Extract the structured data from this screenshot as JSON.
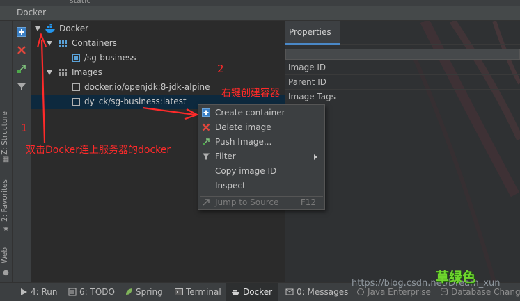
{
  "top_fragment": "static",
  "window_title": "Docker",
  "side_tabs": {
    "structure": "Z: Structure",
    "favorites": "2: Favorites",
    "web": "Web"
  },
  "tree": {
    "root": "Docker",
    "containers_label": "Containers",
    "container_item": "/sg-business",
    "images_label": "Images",
    "image_1": "docker.io/openjdk:8-jdk-alpine",
    "image_2": "dy_ck/sg-business:latest"
  },
  "properties": {
    "tab_label": "Properties",
    "rows": [
      "Image ID",
      "Parent ID",
      "Image Tags"
    ]
  },
  "context_menu": {
    "create_container": "Create container",
    "delete_image": "Delete image",
    "push_image": "Push Image...",
    "filter": "Filter",
    "copy_image_id": "Copy image ID",
    "inspect": "Inspect",
    "jump_to_source": "Jump to Source",
    "jump_shortcut": "F12"
  },
  "bottom_tabs": {
    "run": "4: Run",
    "todo": "6: TODO",
    "spring": "Spring",
    "terminal": "Terminal",
    "docker": "Docker",
    "messages": "0: Messages",
    "java_enterprise": "Java Enterprise",
    "database_changes": "Database Changes"
  },
  "annotations": {
    "step_1": "1",
    "step_1_text": "双击Docker连上服务器的docker",
    "step_2": "2",
    "step_2_text": "右键创建容器"
  },
  "watermark": "https://blog.csdn.net/Dream_xun",
  "logo_text": "草绿色",
  "colors": {
    "annotation": "#ff2a2a",
    "selection": "#0d293e",
    "accent": "#4a88c7"
  }
}
